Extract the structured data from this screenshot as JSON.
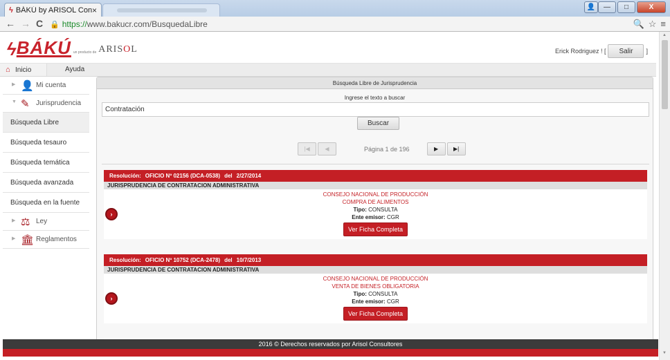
{
  "browser": {
    "tab_title": "BÁKÚ by ARISOL Consulto",
    "tab_close": "×",
    "url_secure": "https://",
    "url_rest": "www.bakucr.com/BusquedaLibre",
    "back": "←",
    "forward": "→",
    "reload": "C",
    "lock": "🔒",
    "zoom_icon": "🔍",
    "star_icon": "☆",
    "menu_icon": "≡",
    "win_user": "👤",
    "win_min": "—",
    "win_max": "□",
    "win_close": "X"
  },
  "header": {
    "logo_bolt": "ϟ",
    "logo_text": "BÁKÚ",
    "logo_sub": "un producto de",
    "logo_arisol_a": "ARIS",
    "logo_arisol_b": "O",
    "logo_arisol_c": "L",
    "user_name": "Erick Rodriguez ! [",
    "logout_label": "Salir",
    "bracket_close": "]"
  },
  "nav": {
    "home_icon": "⌂",
    "inicio": "Inicio",
    "ayuda": "Ayuda"
  },
  "sidebar": {
    "items": [
      {
        "label": "Mi cuenta",
        "icon": "👤",
        "caret": "▶"
      },
      {
        "label": "Jurisprudencia",
        "icon": "✎",
        "caret": "▼"
      },
      {
        "label": "Búsqueda Libre"
      },
      {
        "label": "Búsqueda tesauro"
      },
      {
        "label": "Búsqueda temática"
      },
      {
        "label": "Búsqueda avanzada"
      },
      {
        "label": "Búsqueda en la fuente"
      },
      {
        "label": "Ley",
        "icon": "⚖",
        "caret": "▶"
      },
      {
        "label": "Reglamentos",
        "icon": "🏛",
        "caret": "▶"
      }
    ]
  },
  "main": {
    "panel_title": "Búsqueda Libre de Jurisprudencia",
    "search_label": "Ingrese el texto a buscar",
    "search_value": "Contratación",
    "search_button": "Buscar",
    "pager": {
      "first": "|◀",
      "prev": "◀",
      "text": "Página 1 de 196",
      "next": "▶",
      "last": "▶|"
    },
    "results": [
      {
        "res_label": "Resolución:",
        "res_number": "OFICIO Nº 02156 (DCA-0538)",
        "date_label": "del",
        "date": "2/27/2014",
        "category": "JURISPRUDENCIA DE CONTRATACION ADMINISTRATIVA",
        "title": "CONSEJO NACIONAL DE PRODUCCIÓN",
        "subject": "COMPRA DE ALIMENTOS",
        "tipo_label": "Tipo:",
        "tipo": "CONSULTA",
        "ente_label": "Ente emisor:",
        "ente": "CGR",
        "button": "Ver Ficha Completa",
        "arrow": "›"
      },
      {
        "res_label": "Resolución:",
        "res_number": "OFICIO Nº 10752 (DCA-2478)",
        "date_label": "del",
        "date": "10/7/2013",
        "category": "JURISPRUDENCIA DE CONTRATACION ADMINISTRATIVA",
        "title": "CONSEJO NACIONAL DE PRODUCCIÓN",
        "subject": "VENTA DE BIENES OBLIGATORIA",
        "tipo_label": "Tipo:",
        "tipo": "CONSULTA",
        "ente_label": "Ente emisor:",
        "ente": "CGR",
        "button": "Ver Ficha Completa",
        "arrow": "›"
      }
    ]
  },
  "footer": {
    "text": "2016 © Derechos reservados por Arisol Consultores"
  }
}
